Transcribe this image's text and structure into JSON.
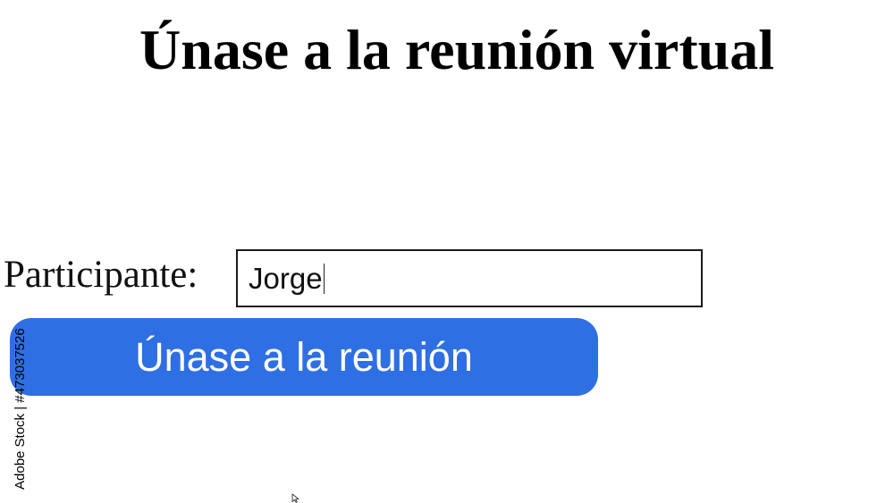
{
  "header": {
    "title": "Únase a la reunión virtual"
  },
  "form": {
    "participant_label": "Participante:",
    "participant_value": "Jorge",
    "join_button_label": "Únase a la reunión"
  },
  "credit": {
    "text": "Adobe Stock | #473037526"
  },
  "colors": {
    "button_background": "#2f6fe4",
    "button_text": "#ffffff",
    "page_background": "#ffffff"
  },
  "icons": {
    "cursor": "mouse-pointer-icon"
  }
}
